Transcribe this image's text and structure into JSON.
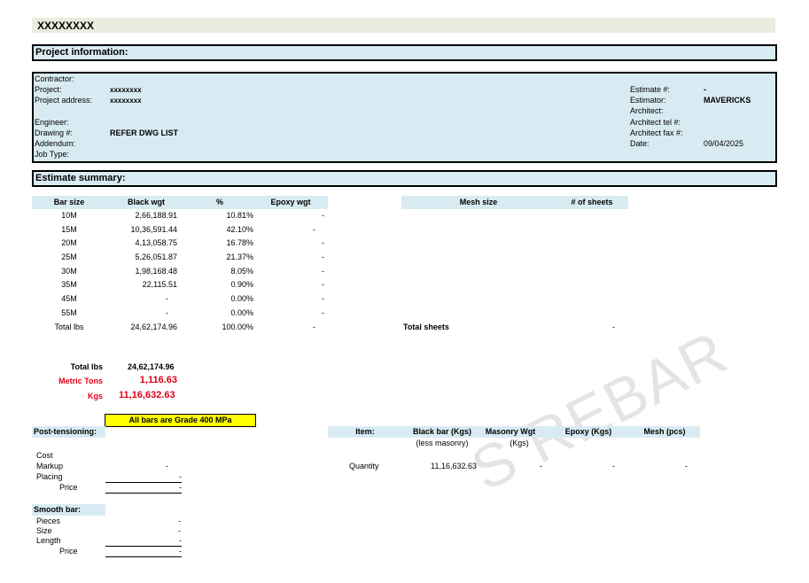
{
  "title": "XXXXXXXX",
  "watermark": "S REBAR",
  "sections": {
    "project_info": "Project information:",
    "estimate_summary": "Estimate summary:"
  },
  "project": {
    "left_labels": [
      "Contractor:",
      "Project:",
      "Project address:",
      "",
      "Engineer:",
      "Drawing #:",
      "Addendum:",
      "Job Type:"
    ],
    "left_values": [
      "",
      "xxxxxxxx",
      "xxxxxxxx",
      "",
      "",
      "REFER DWG LIST",
      "",
      ""
    ],
    "right_labels": [
      "Estimate #:",
      "Estimator:",
      "Architect:",
      "Architect tel #:",
      "Architect fax #:",
      "Date:"
    ],
    "right_values": [
      "-",
      "MAVERICKS",
      "",
      "",
      "",
      "09/04/2025"
    ]
  },
  "bar_table": {
    "headers": [
      "Bar size",
      "Black wgt",
      "%",
      "Epoxy wgt"
    ],
    "rows": [
      [
        "10M",
        "2,66,188.91",
        "10.81%",
        "-"
      ],
      [
        "15M",
        "10,36,591.44",
        "42.10%",
        "-"
      ],
      [
        "20M",
        "4,13,058.75",
        "16.78%",
        "-"
      ],
      [
        "25M",
        "5,26,051.87",
        "21.37%",
        "-"
      ],
      [
        "30M",
        "1,98,168.48",
        "8.05%",
        "-"
      ],
      [
        "35M",
        "22,115.51",
        "0.90%",
        "-"
      ],
      [
        "45M",
        "-",
        "0.00%",
        "-"
      ],
      [
        "55M",
        "-",
        "0.00%",
        "-"
      ],
      [
        "Total lbs",
        "24,62,174.96",
        "100.00%",
        "-"
      ]
    ]
  },
  "mesh_table": {
    "headers": [
      "Mesh size",
      "# of sheets"
    ],
    "total_label": "Total sheets",
    "total_value": "-"
  },
  "totals": {
    "total_lbs_label": "Total lbs",
    "total_lbs_value": "24,62,174.96",
    "metric_tons_label": "Metric Tons",
    "metric_tons_value": "1,116.63",
    "kgs_label": "Kgs",
    "kgs_value": "11,16,632.63"
  },
  "grade_note": "All bars are Grade 400 MPa",
  "post_tensioning": {
    "heading": "Post-tensioning:",
    "rows": [
      {
        "label": "Cost",
        "value": ""
      },
      {
        "label": "Markup",
        "value": "-"
      },
      {
        "label": "Placing",
        "value": "-"
      },
      {
        "label": "Price",
        "value": "-"
      }
    ]
  },
  "smooth_bar": {
    "heading": "Smooth bar:",
    "rows": [
      {
        "label": "Pieces",
        "value": "-"
      },
      {
        "label": "Size",
        "value": "-"
      },
      {
        "label": "Length",
        "value": "-"
      },
      {
        "label": "Price",
        "value": "-"
      }
    ]
  },
  "item_table": {
    "headers": [
      "Item:",
      "Black bar (Kgs)",
      "Masonry Wgt",
      "Epoxy  (Kgs)",
      "Mesh (pcs)"
    ],
    "subheaders": [
      "(less masonry)",
      "(Kgs)"
    ],
    "row": [
      "Quantity",
      "11,16,632.63",
      "-",
      "-",
      "-"
    ]
  },
  "colors": {
    "section_fill": "#d9ebf2",
    "title_fill": "#ecebe0",
    "highlight_yellow": "#ffff00",
    "emphasis_red": "#e0001a"
  }
}
